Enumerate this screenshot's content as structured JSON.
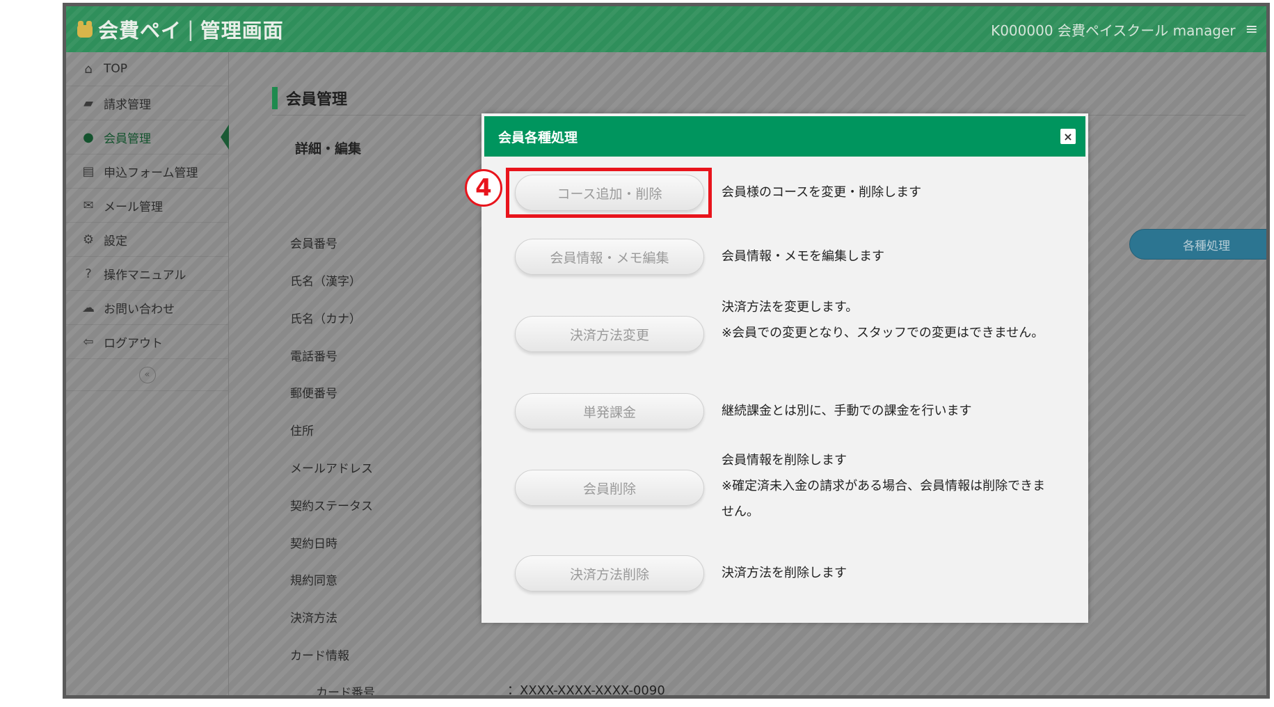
{
  "app": {
    "brand": "会費ペイ",
    "brand_sub": "管理画面",
    "account": "K000000 会費ペイスクール manager"
  },
  "sidebar": {
    "items": [
      {
        "label": "TOP",
        "icon": "home-icon",
        "active": false
      },
      {
        "label": "請求管理",
        "icon": "book-icon",
        "active": false
      },
      {
        "label": "会員管理",
        "icon": "user-icon",
        "active": true
      },
      {
        "label": "申込フォーム管理",
        "icon": "form-icon",
        "active": false
      },
      {
        "label": "メール管理",
        "icon": "envelope-icon",
        "active": false
      },
      {
        "label": "設定",
        "icon": "gears-icon",
        "active": false
      },
      {
        "label": "操作マニュアル",
        "icon": "question-icon",
        "active": false
      },
      {
        "label": "お問い合わせ",
        "icon": "chat-icon",
        "active": false
      },
      {
        "label": "ログアウト",
        "icon": "logout-icon",
        "active": false
      }
    ]
  },
  "main": {
    "title": "会員管理",
    "subhead": "詳細・編集",
    "actions_button": "各種処理",
    "fields": [
      "会員番号",
      "氏名（漢字）",
      "氏名（カナ）",
      "電話番号",
      "郵便番号",
      "住所",
      "メールアドレス",
      "契約ステータス",
      "契約日時",
      "規約同意",
      "決済方法",
      "カード情報"
    ],
    "card_number_label": "カード番号",
    "card_number_value": "：XXXX-XXXX-XXXX-0090"
  },
  "modal": {
    "title": "会員各種処理",
    "close": "×",
    "step_badge": "4",
    "actions": [
      {
        "label": "コース追加・削除",
        "desc": "会員様のコースを変更・削除します"
      },
      {
        "label": "会員情報・メモ編集",
        "desc": "会員情報・メモを編集します"
      },
      {
        "label": "決済方法変更",
        "desc": "決済方法を変更します。\n※会員での変更となり、スタッフでの変更はできません。"
      },
      {
        "label": "単発課金",
        "desc": "継続課金とは別に、手動での課金を行います"
      },
      {
        "label": "会員削除",
        "desc": "会員情報を削除します\n※確定済未入金の請求がある場合、会員情報は削除できません。"
      },
      {
        "label": "決済方法削除",
        "desc": "決済方法を削除します"
      }
    ]
  },
  "colors": {
    "header_green": "#2f8f5b",
    "modal_header": "#00955e",
    "highlight_red": "#e8141c",
    "pill_blue": "#2c7591"
  }
}
